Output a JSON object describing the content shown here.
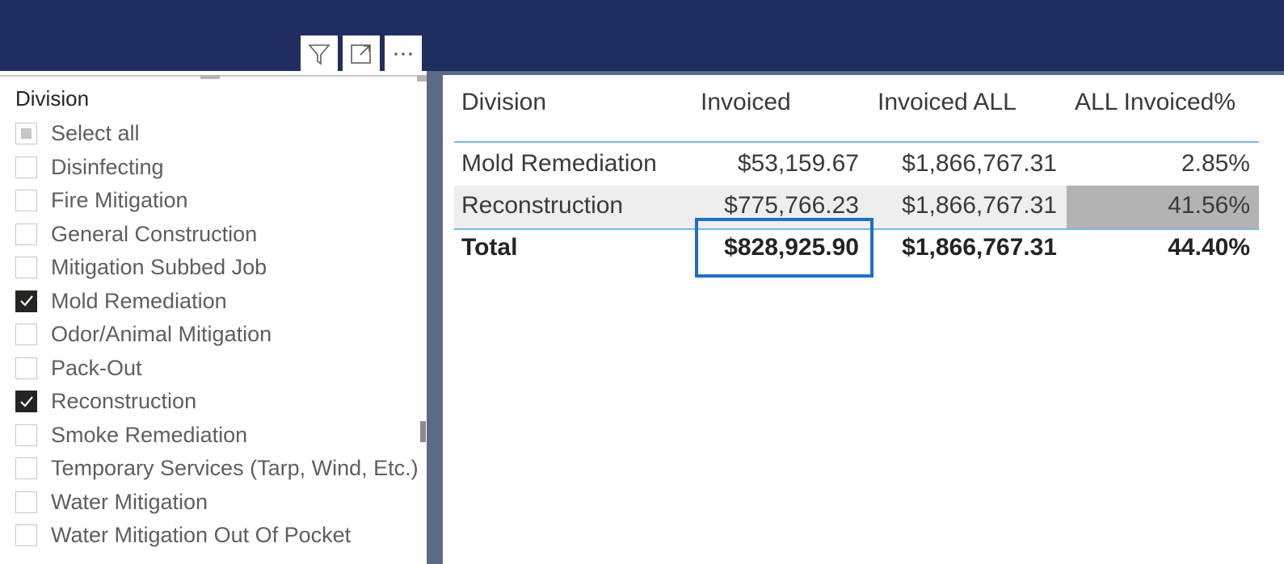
{
  "header": {
    "background": "#202d5f",
    "visual_header_icons": [
      "filter-icon",
      "focus-mode-icon",
      "more-options-icon"
    ]
  },
  "slicer": {
    "title": "Division",
    "items": [
      {
        "label": "Select all",
        "state": "partial"
      },
      {
        "label": "Disinfecting",
        "state": "unchecked"
      },
      {
        "label": "Fire Mitigation",
        "state": "unchecked"
      },
      {
        "label": "General Construction",
        "state": "unchecked"
      },
      {
        "label": "Mitigation Subbed Job",
        "state": "unchecked"
      },
      {
        "label": "Mold Remediation",
        "state": "checked"
      },
      {
        "label": "Odor/Animal Mitigation",
        "state": "unchecked"
      },
      {
        "label": "Pack-Out",
        "state": "unchecked"
      },
      {
        "label": "Reconstruction",
        "state": "checked"
      },
      {
        "label": "Smoke Remediation",
        "state": "unchecked"
      },
      {
        "label": "Temporary Services (Tarp, Wind, Etc.)",
        "state": "unchecked"
      },
      {
        "label": "Water Mitigation",
        "state": "unchecked"
      },
      {
        "label": "Water Mitigation Out Of Pocket",
        "state": "unchecked"
      }
    ]
  },
  "table": {
    "columns": [
      "Division",
      "Invoiced",
      "Invoiced ALL",
      "ALL Invoiced%"
    ],
    "rows": [
      [
        "Mold Remediation",
        "$53,159.67",
        "$1,866,767.31",
        "2.85%"
      ],
      [
        "Reconstruction",
        "$775,766.23",
        "$1,866,767.31",
        "41.56%"
      ]
    ],
    "total": [
      "Total",
      "$828,925.90",
      "$1,866,767.31",
      "44.40%"
    ],
    "highlight_color": "#1f6fc6",
    "accent_rule_color": "#7fb5e6"
  }
}
